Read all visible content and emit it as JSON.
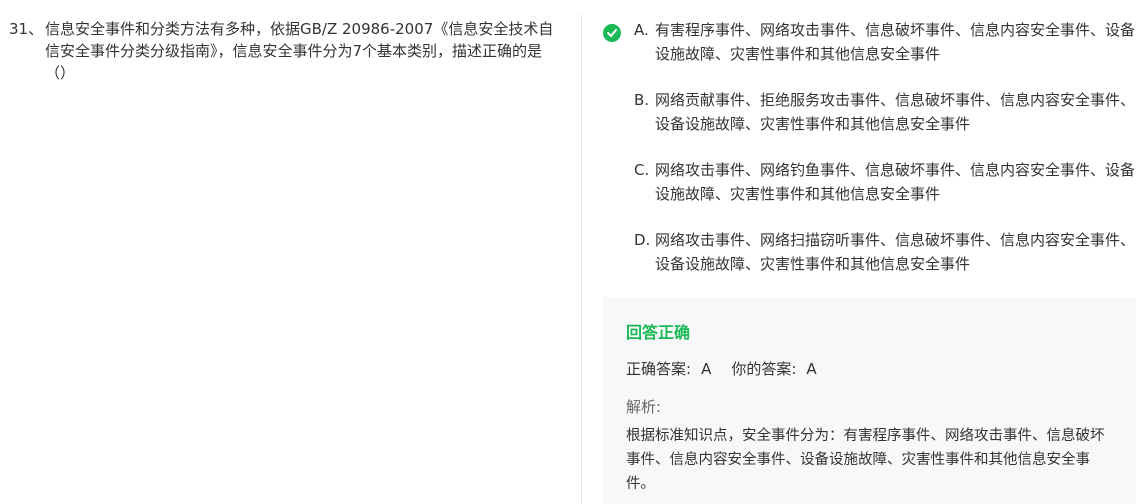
{
  "question": {
    "number": "31、",
    "text": "信息安全事件和分类方法有多种，依据GB/Z 20986-2007《信息安全技术自信安全事件分类分级指南》，信息安全事件分为7个基本类别，描述正确的是（）"
  },
  "options": [
    {
      "letter": "A.",
      "text": "有害程序事件、网络攻击事件、信息破坏事件、信息内容安全事件、设备设施故障、灾害性事件和其他信息安全事件",
      "selected_correct": true
    },
    {
      "letter": "B.",
      "text": "网络贡献事件、拒绝服务攻击事件、信息破坏事件、信息内容安全事件、设备设施故障、灾害性事件和其他信息安全事件",
      "selected_correct": false
    },
    {
      "letter": "C.",
      "text": "网络攻击事件、网络钓鱼事件、信息破坏事件、信息内容安全事件、设备设施故障、灾害性事件和其他信息安全事件",
      "selected_correct": false
    },
    {
      "letter": "D.",
      "text": "网络攻击事件、网络扫描窃听事件、信息破坏事件、信息内容安全事件、设备设施故障、灾害性事件和其他信息安全事件",
      "selected_correct": false
    }
  ],
  "result": {
    "status": "回答正确",
    "correct_label": "正确答案:",
    "correct_value": "A",
    "your_label": "你的答案:",
    "your_value": "A",
    "explanation_label": "解析:",
    "explanation": "根据标准知识点，安全事件分为：有害程序事件、网络攻击事件、信息破坏事件、信息内容安全事件、设备设施故障、灾害性事件和其他信息安全事件。"
  },
  "colors": {
    "accent_green": "#19b955",
    "panel_bg": "#f7f8fa",
    "text": "#333333"
  },
  "icons": {
    "correct": "check-circle-icon"
  }
}
